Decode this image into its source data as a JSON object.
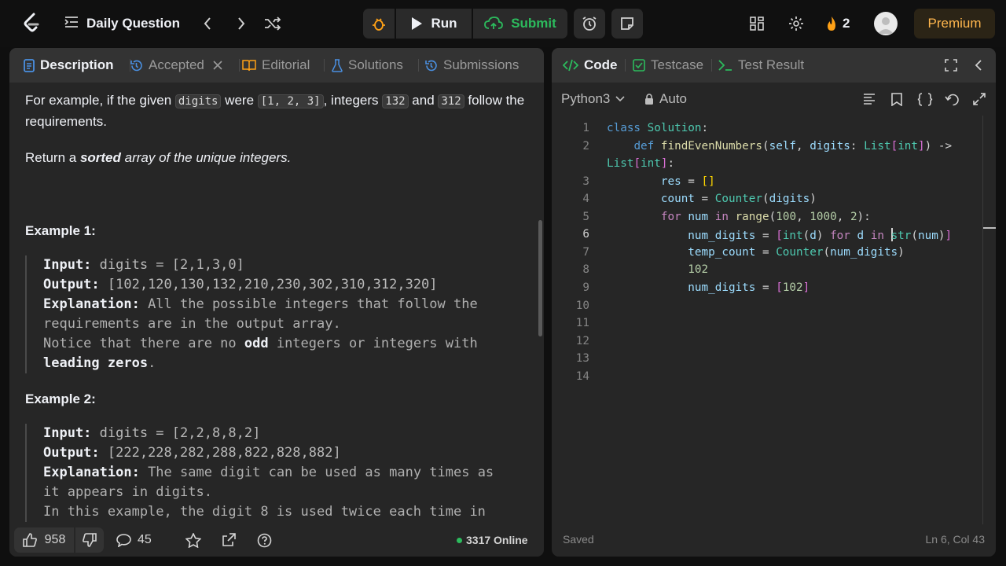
{
  "nav": {
    "list_title": "Daily Question",
    "run_label": "Run",
    "submit_label": "Submit",
    "streak_count": "2",
    "premium_label": "Premium"
  },
  "left_tabs": [
    "Description",
    "Accepted",
    "Editorial",
    "Solutions",
    "Submissions"
  ],
  "description": {
    "para1_a": "For example, if the given ",
    "para1_code1": "digits",
    "para1_b": " were ",
    "para1_code2": "[1, 2, 3]",
    "para1_c": ", integers ",
    "para1_code3": "132",
    "para1_d": " and ",
    "para1_code4": "312",
    "para1_e": " follow the requirements.",
    "para2_a": "Return a ",
    "para2_b": "sorted",
    "para2_c": " array of the unique integers.",
    "example1": {
      "title": "Example 1:",
      "input_label": "Input:",
      "input": " digits = [2,1,3,0]",
      "output_label": "Output:",
      "output": " [102,120,130,132,210,230,302,310,312,320]",
      "expl_label": "Explanation:",
      "expl_1": " All the possible integers that follow the",
      "expl_2": "requirements are in the output array.",
      "notice_a": "Notice that there are no ",
      "notice_b": "odd",
      "notice_c": " integers or integers with",
      "notice_d": "leading zeros",
      "notice_e": "."
    },
    "example2": {
      "title": "Example 2:",
      "input_label": "Input:",
      "input": " digits = [2,2,8,8,2]",
      "output_label": "Output:",
      "output": " [222,228,282,288,822,828,882]",
      "expl_label": "Explanation:",
      "expl_1": " The same digit can be used as many times as",
      "expl_2": "it appears in digits.",
      "expl_3": "In this example, the digit 8 is used twice each time in"
    }
  },
  "footer": {
    "likes": "958",
    "comments": "45",
    "online": "3317 Online"
  },
  "right_tabs": [
    "Code",
    "Testcase",
    "Test Result"
  ],
  "editor": {
    "language": "Python3",
    "mode": "Auto",
    "saved": "Saved",
    "cursor_pos": "Ln 6, Col 43",
    "line_numbers": [
      "1",
      "2",
      "",
      "3",
      "4",
      "5",
      "6",
      "7",
      "8",
      "9",
      "10",
      "11",
      "12",
      "13",
      "14"
    ]
  },
  "colors": {
    "accent_green": "#2cbb5d",
    "premium_orange": "#ffb64d",
    "streak_orange": "#ffa116"
  }
}
